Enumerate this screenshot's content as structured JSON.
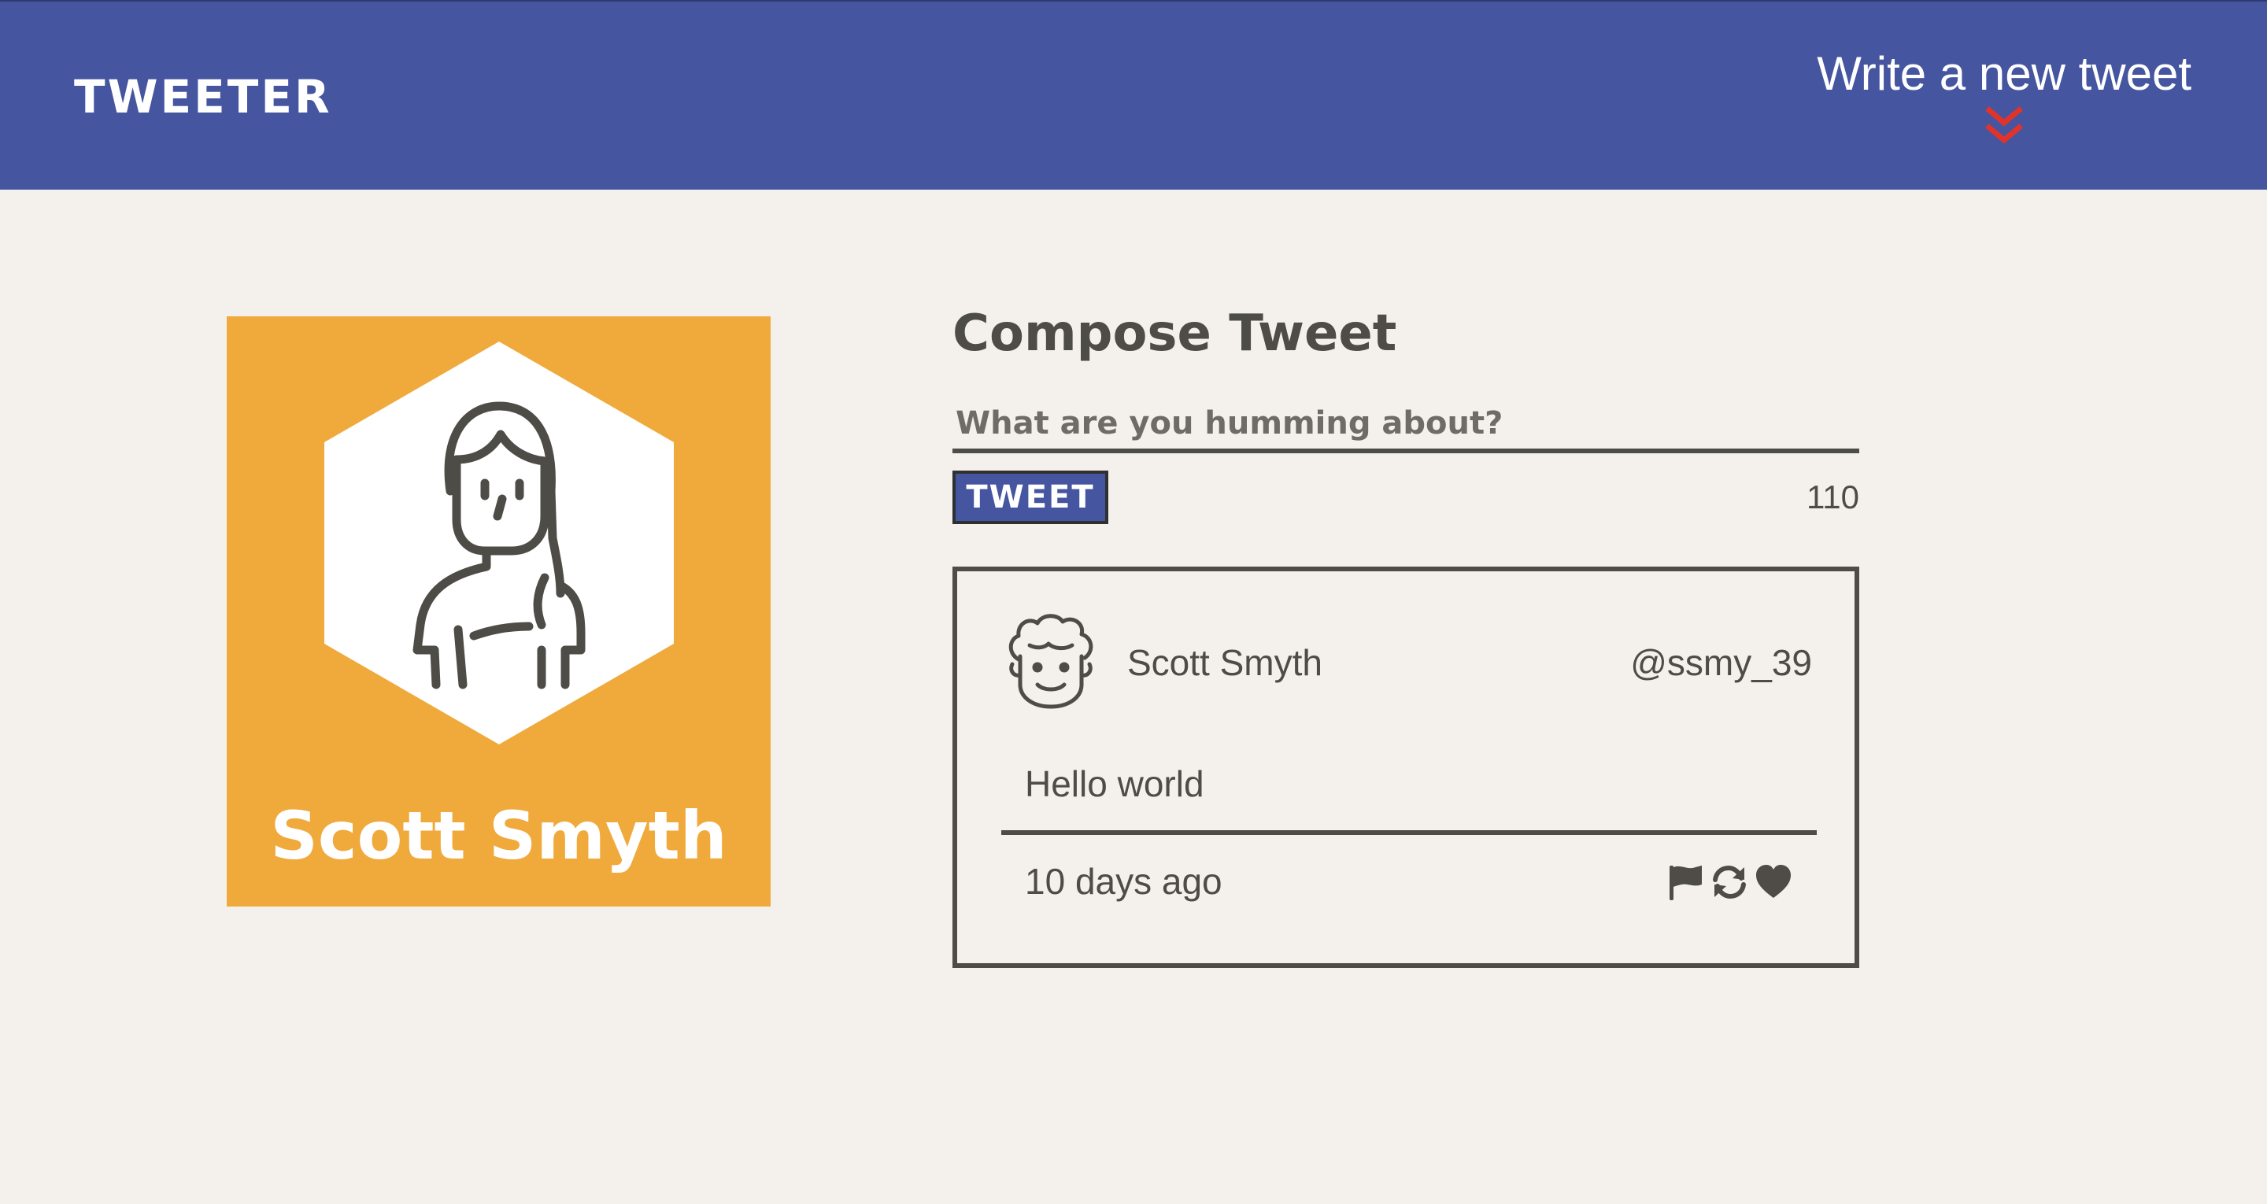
{
  "nav": {
    "brand": "TWEETER",
    "new_tweet_label": "Write a new tweet",
    "new_tweet_icon": "double-chevron-down-icon",
    "accent_color": "#e0342b",
    "background_color": "#4555a0"
  },
  "profile": {
    "name": "Scott Smyth",
    "avatar_icon": "woman-avatar-icon",
    "card_color": "#f0a93b"
  },
  "compose": {
    "title": "Compose Tweet",
    "placeholder": "What are you humming about?",
    "value": "",
    "button_label": "TWEET",
    "char_counter": "110"
  },
  "tweets": [
    {
      "author_name": "Scott Smyth",
      "handle": "@ssmy_39",
      "avatar_icon": "curly-hair-man-avatar-icon",
      "text": "Hello world",
      "timestamp": "10 days ago",
      "actions": [
        "flag-icon",
        "retweet-icon",
        "heart-icon"
      ]
    }
  ]
}
